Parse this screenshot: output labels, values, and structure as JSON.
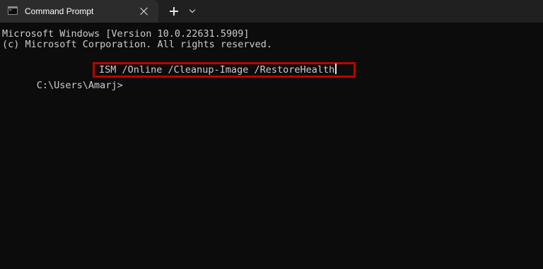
{
  "window": {
    "tab_title": "Command Prompt",
    "tab_icon": "terminal-icon",
    "close_icon": "close-icon",
    "new_tab_icon": "plus-icon",
    "dropdown_icon": "chevron-down-icon"
  },
  "console": {
    "lines": [
      "Microsoft Windows [Version 10.0.22631.5909]",
      "(c) Microsoft Corporation. All rights reserved."
    ],
    "prompt": "C:\\Users\\Amarj>",
    "command": "ISM /Online /Cleanup-Image /RestoreHealth",
    "highlight_color": "#c00000",
    "background_color": "#0c0c0c",
    "text_color": "#cccccc"
  }
}
